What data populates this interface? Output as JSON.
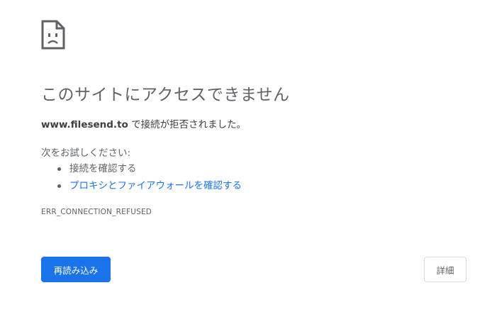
{
  "icon": "sad-page-icon",
  "headline": "このサイトにアクセスできません",
  "summary": {
    "host": "www.filesend.to",
    "message": " で接続が拒否されました。"
  },
  "suggestions": {
    "intro": "次をお試しください:",
    "items": [
      {
        "label": "接続を確認する",
        "is_link": false
      },
      {
        "label": "プロキシとファイアウォールを確認する",
        "is_link": true
      }
    ]
  },
  "error_code": "ERR_CONNECTION_REFUSED",
  "buttons": {
    "reload": "再読み込み",
    "details": "詳細"
  },
  "colors": {
    "primary": "#1a73e8",
    "text": "#5f6368",
    "text_strong": "#3c4043",
    "border": "#dadce0"
  }
}
